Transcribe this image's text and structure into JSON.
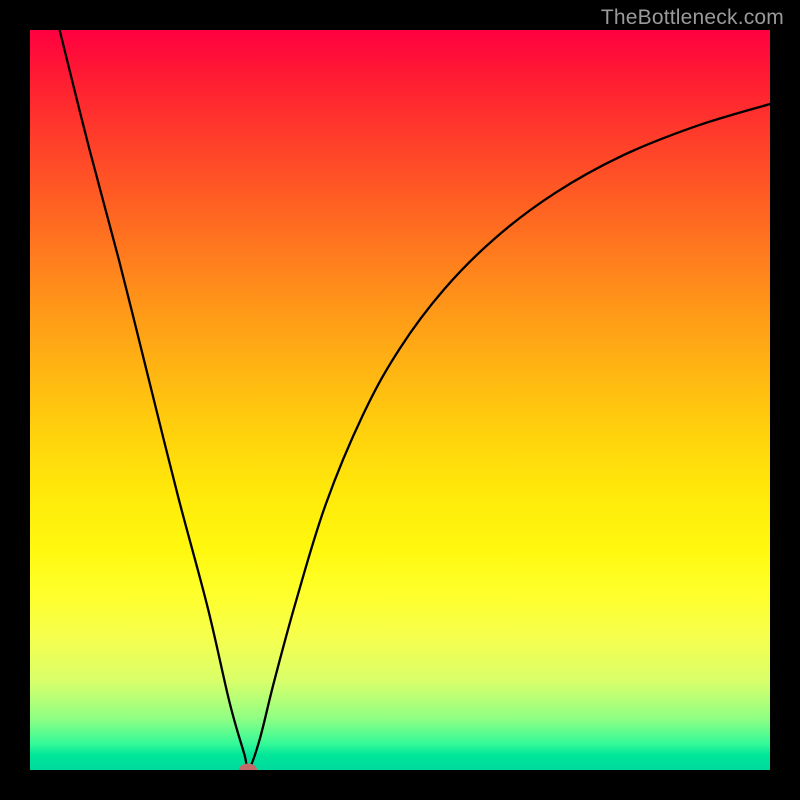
{
  "watermark": "TheBottleneck.com",
  "chart_data": {
    "type": "line",
    "title": "",
    "xlabel": "",
    "ylabel": "",
    "xlim": [
      0,
      100
    ],
    "ylim": [
      0,
      100
    ],
    "grid": false,
    "legend": false,
    "gradient_colors": {
      "top": "#ff0040",
      "mid_upper": "#ff8a1b",
      "mid": "#ffe80a",
      "mid_lower": "#f6ff4d",
      "bottom": "#00d99c"
    },
    "series": [
      {
        "name": "left-branch",
        "type": "line",
        "x": [
          4,
          8,
          12,
          16,
          20,
          24,
          27,
          29,
          29.5
        ],
        "y": [
          100,
          84,
          69,
          53,
          37,
          22,
          9,
          2,
          0
        ]
      },
      {
        "name": "right-branch",
        "type": "line",
        "x": [
          29.5,
          31,
          33,
          36,
          40,
          45,
          50,
          56,
          63,
          71,
          80,
          90,
          100
        ],
        "y": [
          0,
          4,
          12,
          23,
          36,
          48,
          57,
          65,
          72,
          78,
          83,
          87,
          90
        ]
      }
    ],
    "marker": {
      "x": 29.5,
      "y": 0,
      "color": "#c46a6a",
      "shape": "ellipse"
    }
  }
}
